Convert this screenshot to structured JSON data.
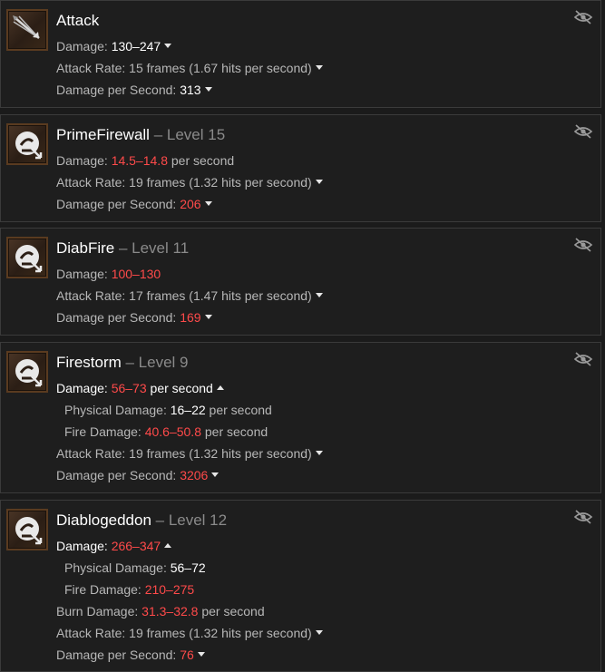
{
  "cards": [
    {
      "icon": "arrows-icon",
      "name": "Attack",
      "level": "",
      "damage_label": "Damage: ",
      "damage_value": "130–247",
      "attack_rate_label": "Attack Rate: ",
      "attack_rate_value": "15 frames (1.67 hits per second)",
      "dps_label": "Damage per Second: ",
      "dps_value": "313"
    },
    {
      "icon": "skill-icon",
      "name": "PrimeFirewall",
      "level": " – Level 15",
      "damage_label": "Damage: ",
      "damage_value": "14.5–14.8",
      "damage_suffix": " per second",
      "attack_rate_label": "Attack Rate: ",
      "attack_rate_value": "19 frames (1.32 hits per second)",
      "dps_label": "Damage per Second: ",
      "dps_value": "206"
    },
    {
      "icon": "skill-icon",
      "name": "DiabFire",
      "level": " – Level 11",
      "damage_label": "Damage: ",
      "damage_value": "100–130",
      "attack_rate_label": "Attack Rate: ",
      "attack_rate_value": "17 frames (1.47 hits per second)",
      "dps_label": "Damage per Second: ",
      "dps_value": "169"
    },
    {
      "icon": "skill-icon",
      "name": "Firestorm",
      "level": " – Level 9",
      "damage_label": "Damage: ",
      "damage_value": "56–73",
      "damage_suffix": " per second",
      "physical_label": "Physical Damage: ",
      "physical_value": "16–22",
      "physical_suffix": " per second",
      "fire_label": "Fire Damage: ",
      "fire_value": "40.6–50.8",
      "fire_suffix": " per second",
      "attack_rate_label": "Attack Rate: ",
      "attack_rate_value": "19 frames (1.32 hits per second)",
      "dps_label": "Damage per Second: ",
      "dps_value": "3206"
    },
    {
      "icon": "skill-icon",
      "name": "Diablogeddon",
      "level": " – Level 12",
      "damage_label": "Damage: ",
      "damage_value": "266–347",
      "physical_label": "Physical Damage: ",
      "physical_value": "56–72",
      "fire_label": "Fire Damage: ",
      "fire_value": "210–275",
      "burn_label": "Burn Damage: ",
      "burn_value": "31.3–32.8",
      "burn_suffix": " per second",
      "attack_rate_label": "Attack Rate: ",
      "attack_rate_value": "19 frames (1.32 hits per second)",
      "dps_label": "Damage per Second: ",
      "dps_value": "76"
    }
  ],
  "colors": {
    "accent": "#1f6fd6",
    "damage_red": "#ff4a4a",
    "card_bg": "#1e1e1e"
  }
}
